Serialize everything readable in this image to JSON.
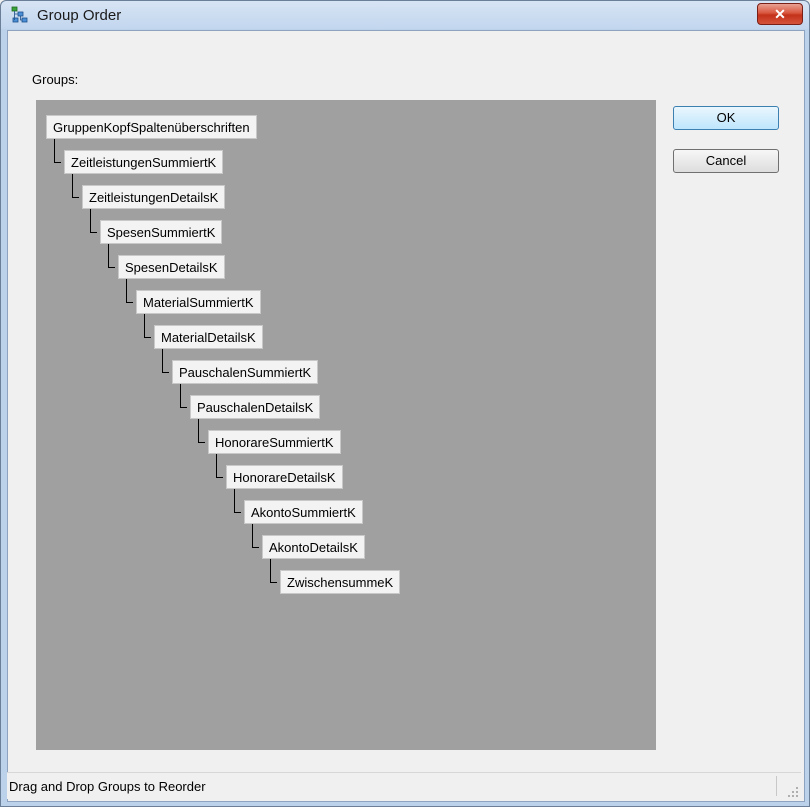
{
  "window": {
    "title": "Group Order",
    "close_glyph": "✕"
  },
  "groups_label": "Groups:",
  "tree": {
    "nodes": [
      "GruppenKopfSpaltenüberschriften",
      "ZeitleistungenSummiertK",
      "ZeitleistungenDetailsK",
      "SpesenSummiertK",
      "SpesenDetailsK",
      "MaterialSummiertK",
      "MaterialDetailsK",
      "PauschalenSummiertK",
      "PauschalenDetailsK",
      "HonorareSummiertK",
      "HonorareDetailsK",
      "AkontoSummiertK",
      "AkontoDetailsK",
      "ZwischensummeK"
    ]
  },
  "buttons": {
    "ok": "OK",
    "cancel": "Cancel"
  },
  "status": {
    "text": "Drag and Drop Groups to Reorder"
  },
  "icons": {
    "app": "group-tree-icon",
    "close": "close-icon",
    "grip": "resize-grip-icon"
  }
}
